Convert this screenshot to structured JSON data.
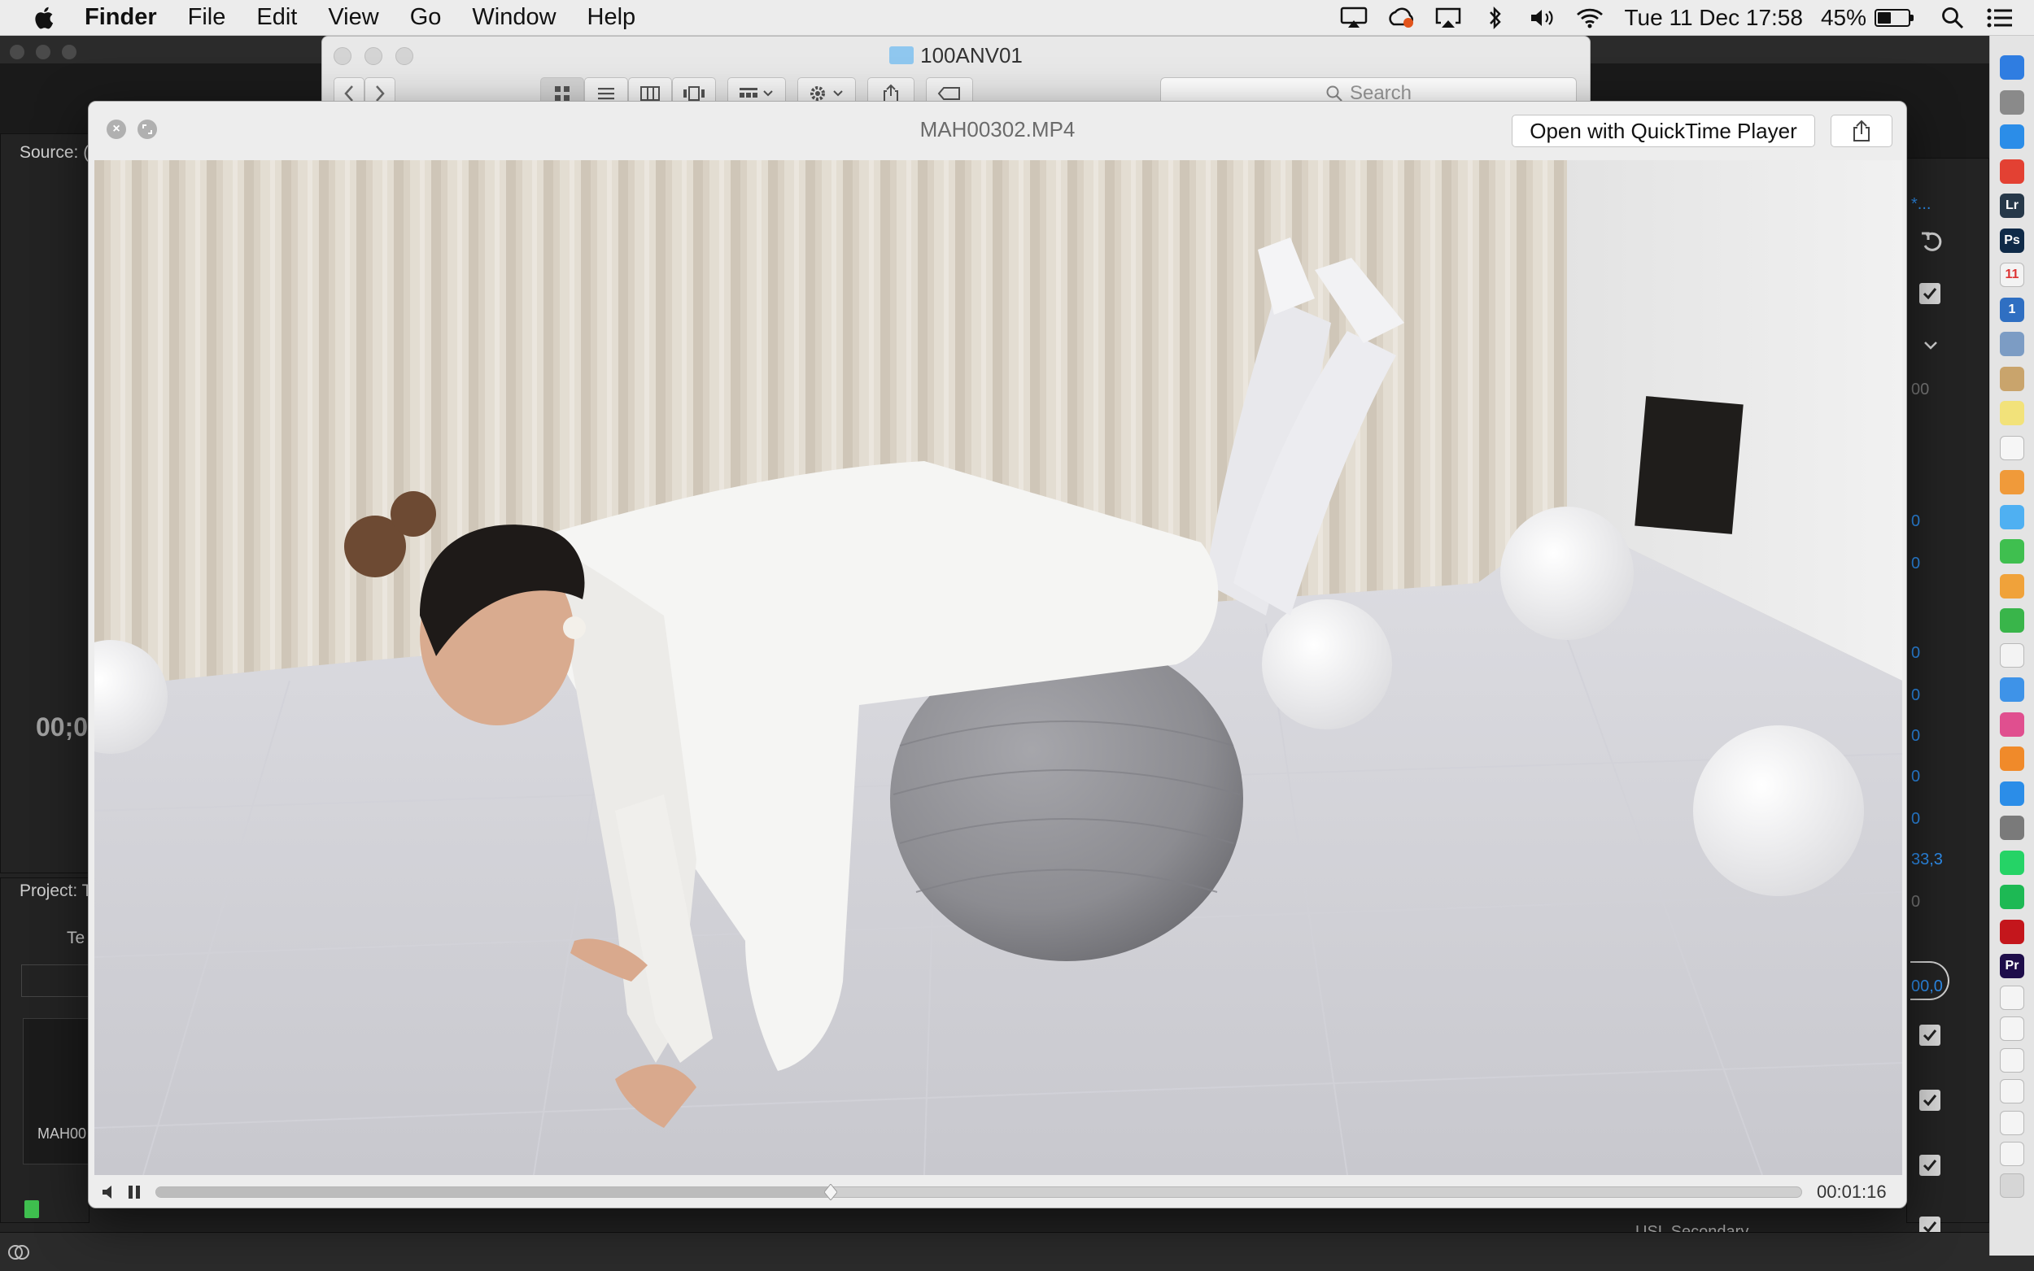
{
  "menubar": {
    "apple_icon": "apple-logo-icon",
    "items": [
      "Finder",
      "File",
      "Edit",
      "View",
      "Go",
      "Window",
      "Help"
    ],
    "clock": "Tue 11 Dec  17:58",
    "battery_percent": "45%",
    "battery_level": 0.45,
    "status_icons": [
      "airplay-display-icon",
      "creative-cloud-icon",
      "screen-mirroring-icon",
      "bluetooth-icon",
      "volume-icon",
      "wifi-icon",
      "battery-icon",
      "spotlight-search-icon",
      "notification-center-icon"
    ]
  },
  "premiere": {
    "source_label": "Source: (",
    "project_label": "Project: T",
    "project_item": "Te",
    "timecode": "00;0",
    "clip_name": "MAH00",
    "right_values": [
      "*...",
      "00",
      "0",
      "0",
      "0",
      "0",
      "0",
      "0",
      "0",
      "33,3",
      "0",
      "00,0"
    ],
    "track_label": "USL Secondary"
  },
  "finder": {
    "title": "100ANV01",
    "search_placeholder": "Search",
    "icons": [
      "back-icon",
      "forward-icon",
      "icon-view-icon",
      "list-view-icon",
      "column-view-icon",
      "cover-flow-icon",
      "group-icon",
      "action-gear-icon",
      "share-icon",
      "tag-icon"
    ]
  },
  "quicklook": {
    "title": "MAH00302.MP4",
    "open_button": "Open with QuickTime Player",
    "time": "00:01:16",
    "progress": 0.41,
    "icons": [
      "close-icon",
      "fullscreen-icon",
      "share-icon",
      "volume-icon",
      "pause-icon"
    ]
  },
  "dock": {
    "apps": [
      {
        "name": "finder",
        "label": "",
        "color": "#2f7de1"
      },
      {
        "name": "launchpad",
        "label": "",
        "color": "#8a8a8a"
      },
      {
        "name": "safari",
        "label": "",
        "color": "#2b8de8"
      },
      {
        "name": "chrome",
        "label": "",
        "color": "#e34133"
      },
      {
        "name": "lightroom",
        "label": "Lr",
        "color": "#263849"
      },
      {
        "name": "photoshop",
        "label": "Ps",
        "color": "#0f2a48"
      },
      {
        "name": "calendar",
        "label": "11",
        "color": "#f3f3f3"
      },
      {
        "name": "1password",
        "label": "1",
        "color": "#2f6fc2"
      },
      {
        "name": "preview",
        "label": "",
        "color": "#7c9cc4"
      },
      {
        "name": "contacts",
        "label": "",
        "color": "#c9a46c"
      },
      {
        "name": "notes",
        "label": "",
        "color": "#f2e27a"
      },
      {
        "name": "reminders",
        "label": "",
        "color": "#f6f6f6"
      },
      {
        "name": "photos",
        "label": "",
        "color": "#f09a3a"
      },
      {
        "name": "messages",
        "label": "",
        "color": "#4fb0f2"
      },
      {
        "name": "facetime",
        "label": "",
        "color": "#3fbf4f"
      },
      {
        "name": "pages",
        "label": "",
        "color": "#f0a23a"
      },
      {
        "name": "numbers",
        "label": "",
        "color": "#39b54a"
      },
      {
        "name": "textedit",
        "label": "",
        "color": "#f3f3f3"
      },
      {
        "name": "mail",
        "label": "",
        "color": "#3e93e8"
      },
      {
        "name": "itunes",
        "label": "",
        "color": "#e04f8f"
      },
      {
        "name": "ibooks",
        "label": "",
        "color": "#f08a2a"
      },
      {
        "name": "app-store",
        "label": "",
        "color": "#2b8de8"
      },
      {
        "name": "system-preferences",
        "label": "",
        "color": "#7a7a7a"
      },
      {
        "name": "whatsapp",
        "label": "",
        "color": "#25d366"
      },
      {
        "name": "spotify",
        "label": "",
        "color": "#1db954"
      },
      {
        "name": "acrobat",
        "label": "",
        "color": "#c4161c"
      },
      {
        "name": "premiere",
        "label": "Pr",
        "color": "#1e0d4a"
      },
      {
        "name": "document-1",
        "label": "",
        "color": "#f4f4f4"
      },
      {
        "name": "document-2",
        "label": "",
        "color": "#f4f4f4"
      },
      {
        "name": "document-3",
        "label": "",
        "color": "#f4f4f4"
      },
      {
        "name": "document-4",
        "label": "",
        "color": "#f4f4f4"
      },
      {
        "name": "document-5",
        "label": "",
        "color": "#f4f4f4"
      },
      {
        "name": "document-6",
        "label": "",
        "color": "#f4f4f4"
      },
      {
        "name": "trash",
        "label": "",
        "color": "#d6d6d6"
      }
    ]
  }
}
